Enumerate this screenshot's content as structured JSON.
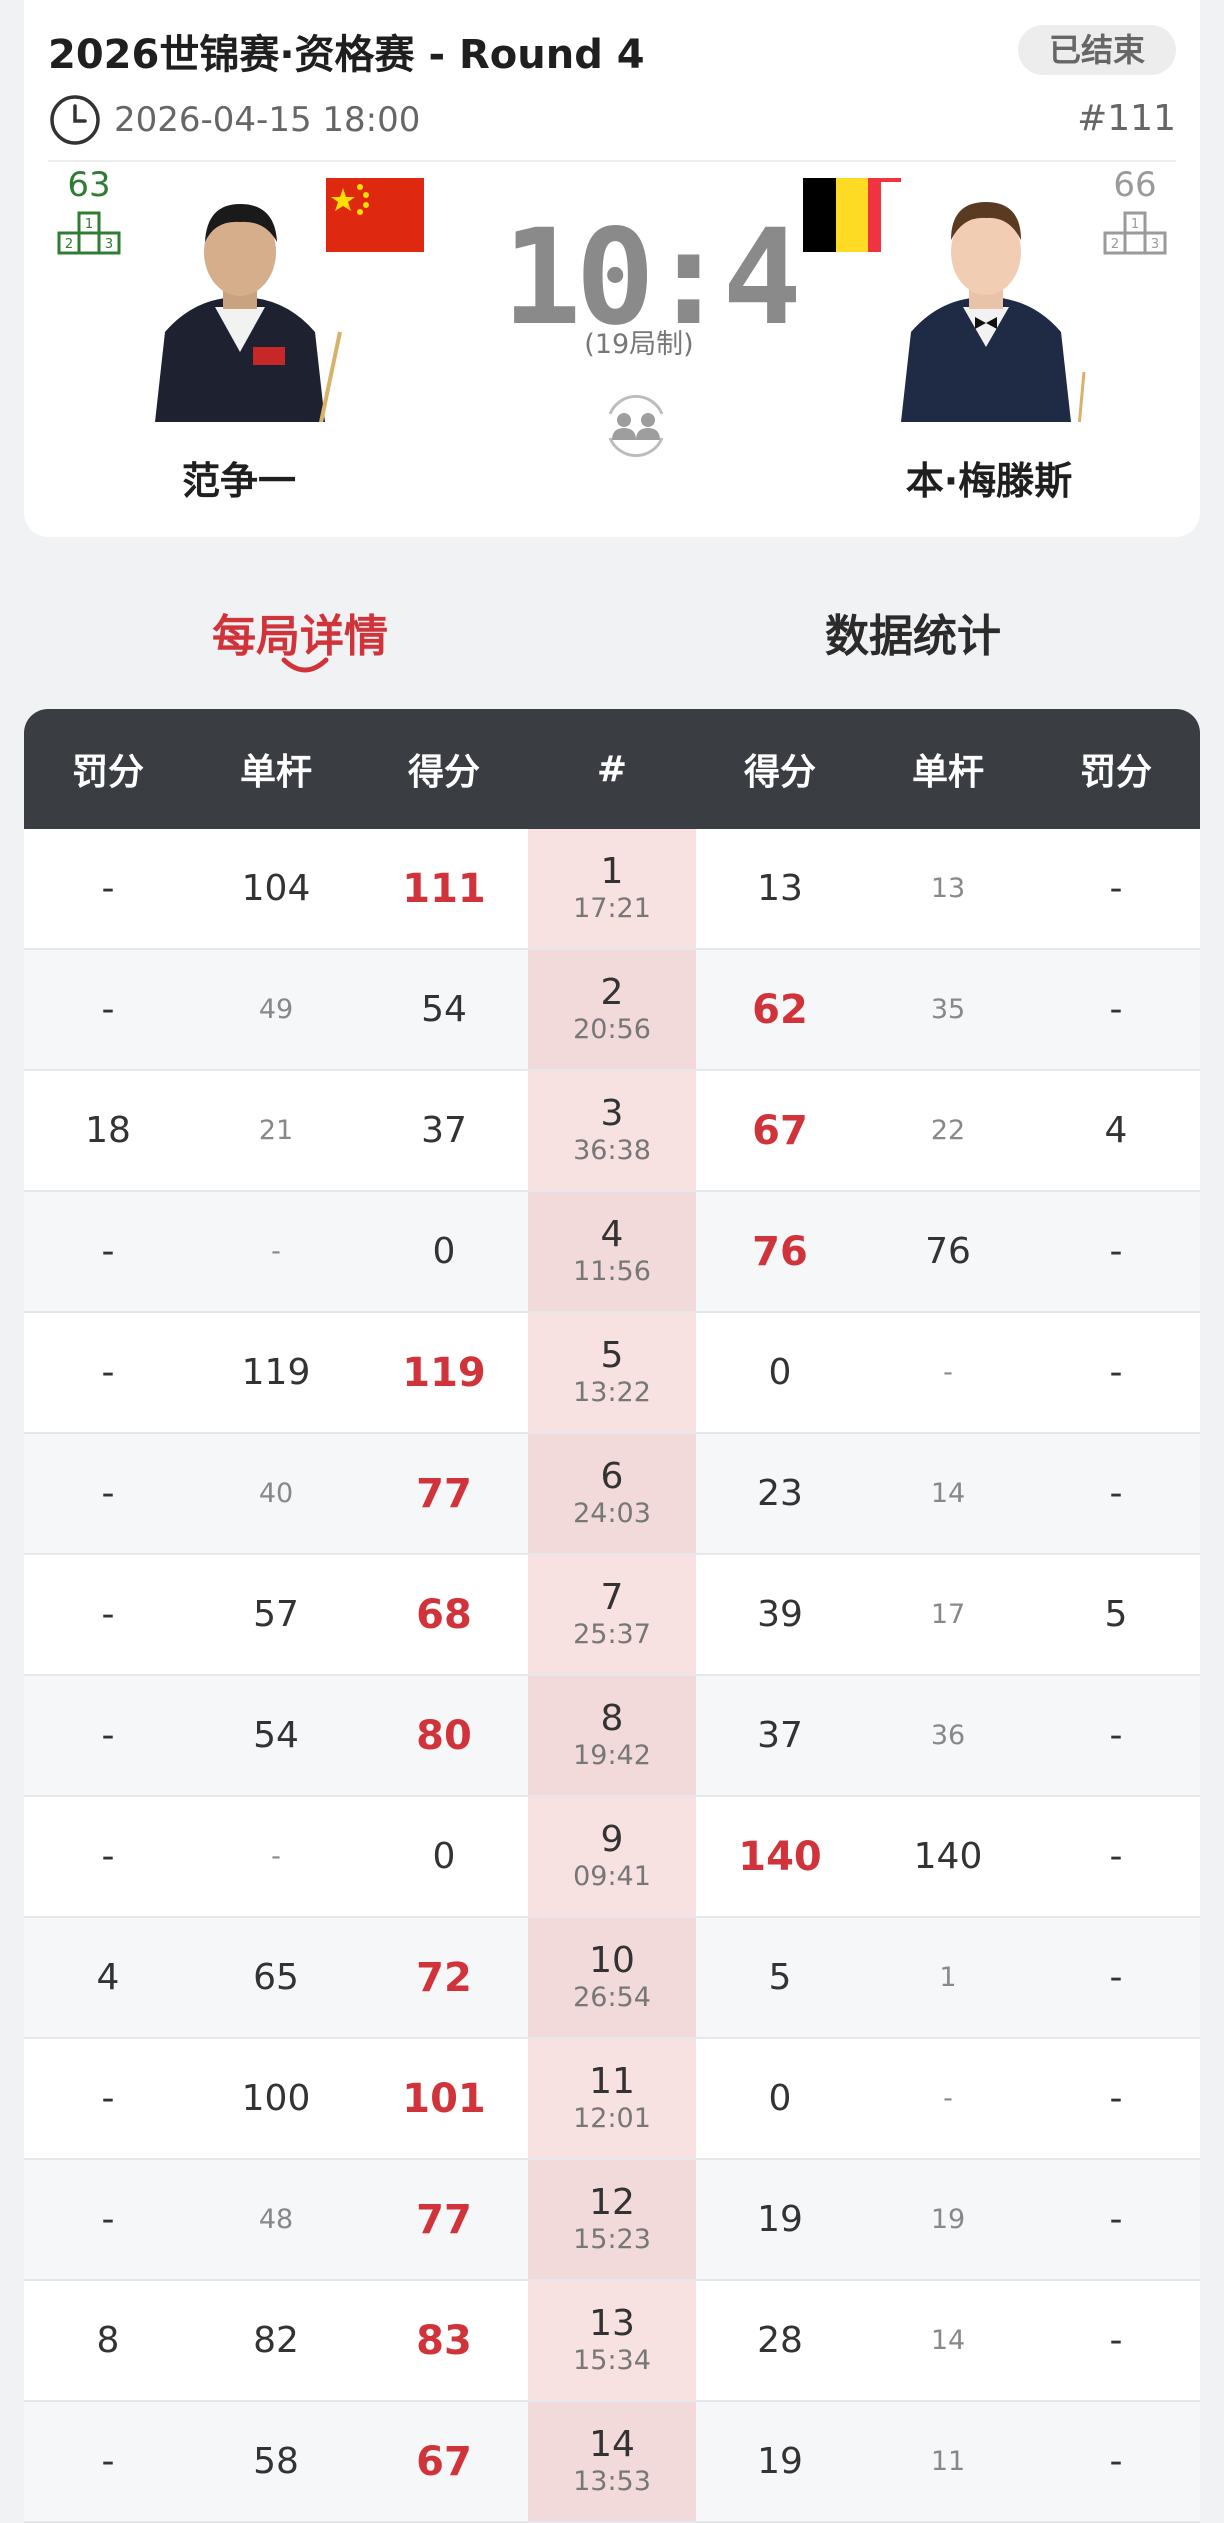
{
  "header": {
    "title": "2026世锦赛·资格赛 - Round 4",
    "status": "已结束",
    "datetime": "2026-04-15 18:00",
    "match_no": "#111"
  },
  "players": {
    "left": {
      "name": "范争一",
      "rank": "63",
      "flag": "china-flag"
    },
    "right": {
      "name": "本·梅滕斯",
      "rank": "66",
      "flag": "belgium-flag"
    }
  },
  "score": {
    "display": "10:4",
    "format": "(19局制)"
  },
  "tabs": {
    "active": "每局详情",
    "inactive": "数据统计"
  },
  "table": {
    "headers": [
      "罚分",
      "单杆",
      "得分",
      "#",
      "得分",
      "单杆",
      "罚分"
    ],
    "rows": [
      {
        "lp": "-",
        "lb": "104",
        "ls": "111",
        "no": "1",
        "time": "17:21",
        "rs": "13",
        "rb": "13",
        "rp": "-"
      },
      {
        "lp": "-",
        "lb": "49",
        "ls": "54",
        "no": "2",
        "time": "20:56",
        "rs": "62",
        "rb": "35",
        "rp": "-"
      },
      {
        "lp": "18",
        "lb": "21",
        "ls": "37",
        "no": "3",
        "time": "36:38",
        "rs": "67",
        "rb": "22",
        "rp": "4"
      },
      {
        "lp": "-",
        "lb": "-",
        "ls": "0",
        "no": "4",
        "time": "11:56",
        "rs": "76",
        "rb": "76",
        "rp": "-"
      },
      {
        "lp": "-",
        "lb": "119",
        "ls": "119",
        "no": "5",
        "time": "13:22",
        "rs": "0",
        "rb": "-",
        "rp": "-"
      },
      {
        "lp": "-",
        "lb": "40",
        "ls": "77",
        "no": "6",
        "time": "24:03",
        "rs": "23",
        "rb": "14",
        "rp": "-"
      },
      {
        "lp": "-",
        "lb": "57",
        "ls": "68",
        "no": "7",
        "time": "25:37",
        "rs": "39",
        "rb": "17",
        "rp": "5"
      },
      {
        "lp": "-",
        "lb": "54",
        "ls": "80",
        "no": "8",
        "time": "19:42",
        "rs": "37",
        "rb": "36",
        "rp": "-"
      },
      {
        "lp": "-",
        "lb": "-",
        "ls": "0",
        "no": "9",
        "time": "09:41",
        "rs": "140",
        "rb": "140",
        "rp": "-"
      },
      {
        "lp": "4",
        "lb": "65",
        "ls": "72",
        "no": "10",
        "time": "26:54",
        "rs": "5",
        "rb": "1",
        "rp": "-"
      },
      {
        "lp": "-",
        "lb": "100",
        "ls": "101",
        "no": "11",
        "time": "12:01",
        "rs": "0",
        "rb": "-",
        "rp": "-"
      },
      {
        "lp": "-",
        "lb": "48",
        "ls": "77",
        "no": "12",
        "time": "15:23",
        "rs": "19",
        "rb": "19",
        "rp": "-"
      },
      {
        "lp": "8",
        "lb": "82",
        "ls": "83",
        "no": "13",
        "time": "15:34",
        "rs": "28",
        "rb": "14",
        "rp": "-"
      },
      {
        "lp": "-",
        "lb": "58",
        "ls": "67",
        "no": "14",
        "time": "13:53",
        "rs": "19",
        "rb": "11",
        "rp": "-"
      }
    ]
  },
  "colors": {
    "accent": "#d0343a",
    "header_bg": "#3a3d42",
    "mid_col": "#f7e1e1",
    "rank_green": "#2e7d32"
  }
}
